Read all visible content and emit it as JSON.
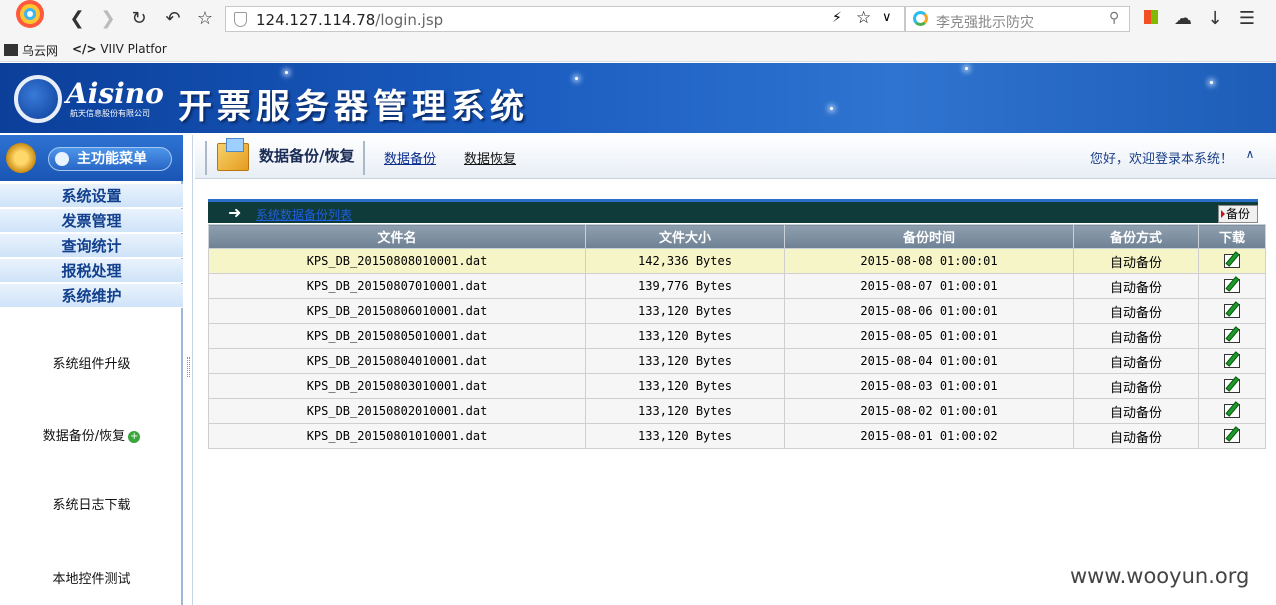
{
  "browser": {
    "url_host": "124.127.114.78",
    "url_path": "/login.jsp",
    "search_placeholder": "李克强批示防灾",
    "bookmarks": [
      {
        "label": "乌云网"
      },
      {
        "label": "VIIV Platfor"
      }
    ]
  },
  "header": {
    "brand": "Aisino",
    "brand_sub": "航天信息股份有限公司",
    "system_title": "开票服务器管理系统"
  },
  "sidebar": {
    "menu_title": "主功能菜单",
    "items": [
      {
        "label": "系统设置"
      },
      {
        "label": "发票管理"
      },
      {
        "label": "查询统计"
      },
      {
        "label": "报税处理"
      },
      {
        "label": "系统维护"
      }
    ],
    "sub_items": [
      {
        "label": "系统组件升级"
      },
      {
        "label": "数据备份/恢复"
      },
      {
        "label": "系统日志下载"
      },
      {
        "label": "本地控件测试"
      }
    ]
  },
  "tabbar": {
    "current": "数据备份/恢复",
    "links": [
      {
        "label": "数据备份"
      },
      {
        "label": "数据恢复"
      }
    ],
    "welcome": "您好，欢迎登录本系统！"
  },
  "panel": {
    "title": "系统数据备份列表",
    "backup_button": "备份"
  },
  "table": {
    "headers": [
      "文件名",
      "文件大小",
      "备份时间",
      "备份方式",
      "下载"
    ],
    "rows": [
      {
        "name": "KPS_DB_20150808010001.dat",
        "size": "142,336 Bytes",
        "time": "2015-08-08 01:00:01",
        "method": "自动备份"
      },
      {
        "name": "KPS_DB_20150807010001.dat",
        "size": "139,776 Bytes",
        "time": "2015-08-07 01:00:01",
        "method": "自动备份"
      },
      {
        "name": "KPS_DB_20150806010001.dat",
        "size": "133,120 Bytes",
        "time": "2015-08-06 01:00:01",
        "method": "自动备份"
      },
      {
        "name": "KPS_DB_20150805010001.dat",
        "size": "133,120 Bytes",
        "time": "2015-08-05 01:00:01",
        "method": "自动备份"
      },
      {
        "name": "KPS_DB_20150804010001.dat",
        "size": "133,120 Bytes",
        "time": "2015-08-04 01:00:01",
        "method": "自动备份"
      },
      {
        "name": "KPS_DB_20150803010001.dat",
        "size": "133,120 Bytes",
        "time": "2015-08-03 01:00:01",
        "method": "自动备份"
      },
      {
        "name": "KPS_DB_20150802010001.dat",
        "size": "133,120 Bytes",
        "time": "2015-08-02 01:00:01",
        "method": "自动备份"
      },
      {
        "name": "KPS_DB_20150801010001.dat",
        "size": "133,120 Bytes",
        "time": "2015-08-01 01:00:02",
        "method": "自动备份"
      }
    ]
  },
  "watermark": "www.wooyun.org",
  "icons": {
    "download": "edit-download-icon",
    "plus": "green-plus-icon"
  }
}
